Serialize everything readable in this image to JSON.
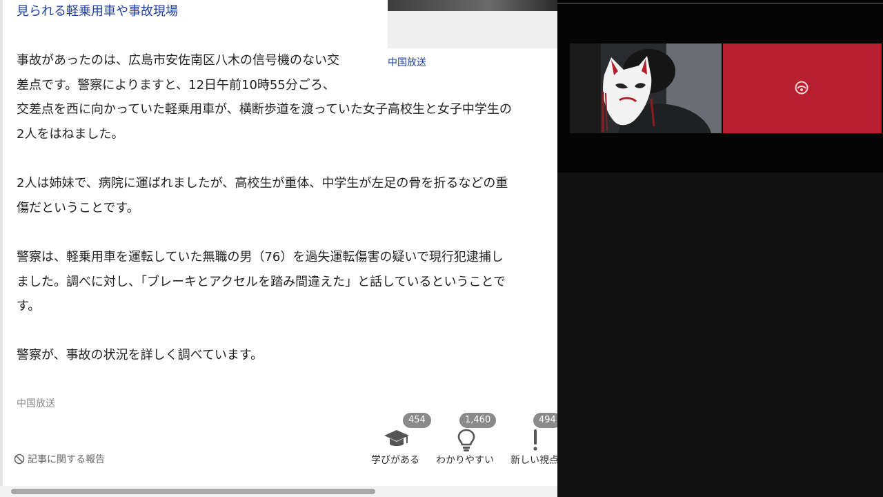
{
  "article": {
    "headline": "見られる軽乗用車や事故現場",
    "thumbnail_source": "中国放送",
    "paragraphs": [
      [
        "事故があったのは、広島市安佐南区八木の信号機のない交",
        "差点です。警察によりますと、12日午前10時55分ごろ、",
        "交差点を西に向かっていた軽乗用車が、横断歩道を渡っていた女子高校生と女子中学生の",
        "2人をはねました。"
      ],
      [
        "2人は姉妹で、病院に運ばれましたが、高校生が重体、中学生が左足の骨を折るなどの重",
        "傷だということです。"
      ],
      [
        "警察は、軽乗用車を運転していた無職の男（76）を過失運転傷害の疑いで現行犯逮捕し",
        "ました。調べに対し、「ブレーキとアクセルを踏み間違えた」と話しているということで",
        "す。"
      ],
      [
        "警察が、事故の状況を詳しく調べています。"
      ]
    ],
    "source": "中国放送"
  },
  "report": {
    "label": "記事に関する報告",
    "icon": "prohibit-icon"
  },
  "reactions": [
    {
      "label": "学びがある",
      "count": "454",
      "icon": "graduation-cap-icon"
    },
    {
      "label": "わかりやすい",
      "count": "1,460",
      "icon": "lightbulb-icon"
    },
    {
      "label": "新しい視点",
      "count": "494",
      "icon": "exclamation-icon"
    }
  ],
  "colors": {
    "link": "#1f3fa0",
    "badge": "#8a8a8a",
    "red_tile": "#b8202f",
    "panel": "#121212"
  }
}
